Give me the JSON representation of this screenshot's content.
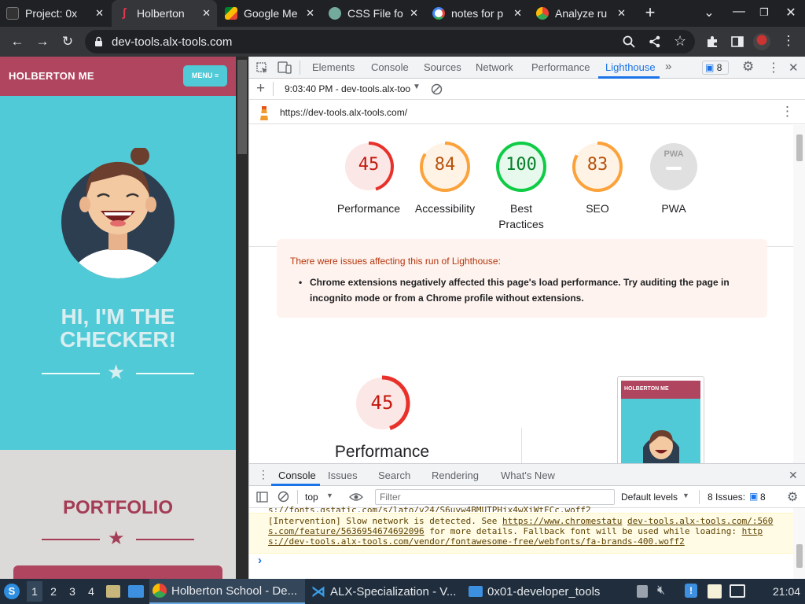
{
  "browser": {
    "tabs": [
      {
        "title": "Project: 0x"
      },
      {
        "title": "Holberton"
      },
      {
        "title": "Google Me"
      },
      {
        "title": "CSS File fo"
      },
      {
        "title": "notes for p"
      },
      {
        "title": "Analyze ru"
      }
    ],
    "url": "dev-tools.alx-tools.com"
  },
  "page": {
    "site_name": "HOLBERTON ME",
    "menu_label": "MENU ≡",
    "hero_title": "HI, I'M THE CHECKER!",
    "portfolio_title": "PORTFOLIO"
  },
  "devtools": {
    "tabs": [
      "Elements",
      "Console",
      "Sources",
      "Network",
      "Performance",
      "Lighthouse"
    ],
    "active_tab": "Lighthouse",
    "issues_count": "8",
    "report_selector": "9:03:40 PM - dev-tools.alx-too",
    "report_url": "https://dev-tools.alx-tools.com/",
    "scores": [
      {
        "label": "Performance",
        "value": "45",
        "pct": 45,
        "color": "#e8312a",
        "fill": "#fbe8e6",
        "text": "#c4170f"
      },
      {
        "label": "Accessibility",
        "value": "84",
        "pct": 84,
        "color": "#fca23b",
        "fill": "#fff3e6",
        "text": "#b8530c"
      },
      {
        "label": "Best Practices",
        "value": "100",
        "pct": 100,
        "color": "#0fcc45",
        "fill": "#e6f9ec",
        "text": "#08802b"
      },
      {
        "label": "SEO",
        "value": "83",
        "pct": 83,
        "color": "#fca23b",
        "fill": "#fff3e6",
        "text": "#b8530c"
      },
      {
        "label": "PWA",
        "value": "PWA",
        "pct": 0,
        "color": "#e0e0e0",
        "fill": "#e0e0e0",
        "text": "#9e9e9e"
      }
    ],
    "warning": {
      "heading": "There were issues affecting this run of Lighthouse:",
      "item": "Chrome extensions negatively affected this page's load performance. Try auditing the page in incognito mode or from a Chrome profile without extensions."
    },
    "perf_section": {
      "value": "45",
      "label": "Performance"
    },
    "thumb_site_name": "HOLBERTON ME",
    "drawer_tabs": [
      "Console",
      "Issues",
      "Search",
      "Rendering",
      "What's New"
    ],
    "console_context": "top",
    "filter_placeholder": "Filter",
    "levels_label": "Default levels",
    "issues_label": "8 Issues:",
    "issues_badge": "8",
    "console_prev_line": "s://fonts.gstatic.com/s/lato/v24/S6uyw4BMUTPHjx4wXiWtFCc.woff2",
    "console_intervention": {
      "prefix": "[Intervention] Slow network is detected. See ",
      "link1": "https://www.chromestatu",
      "source": "dev-tools.alx-tools.com/:560",
      "link1b": "s.com/feature/5636954674692096",
      "mid": " for more details. Fallback font will be used while loading: ",
      "link2a": "http",
      "link2b": "s://dev-tools.alx-tools.com/vendor/fontawesome-free/webfonts/fa-brands-400.woff2"
    },
    "prompt": "›"
  },
  "taskbar": {
    "workspaces": [
      "1",
      "2",
      "3",
      "4"
    ],
    "tasks": [
      {
        "label": "Holberton School - De..."
      },
      {
        "label": "ALX-Specialization - V..."
      },
      {
        "label": "0x01-developer_tools"
      }
    ],
    "clock": "21:04"
  }
}
